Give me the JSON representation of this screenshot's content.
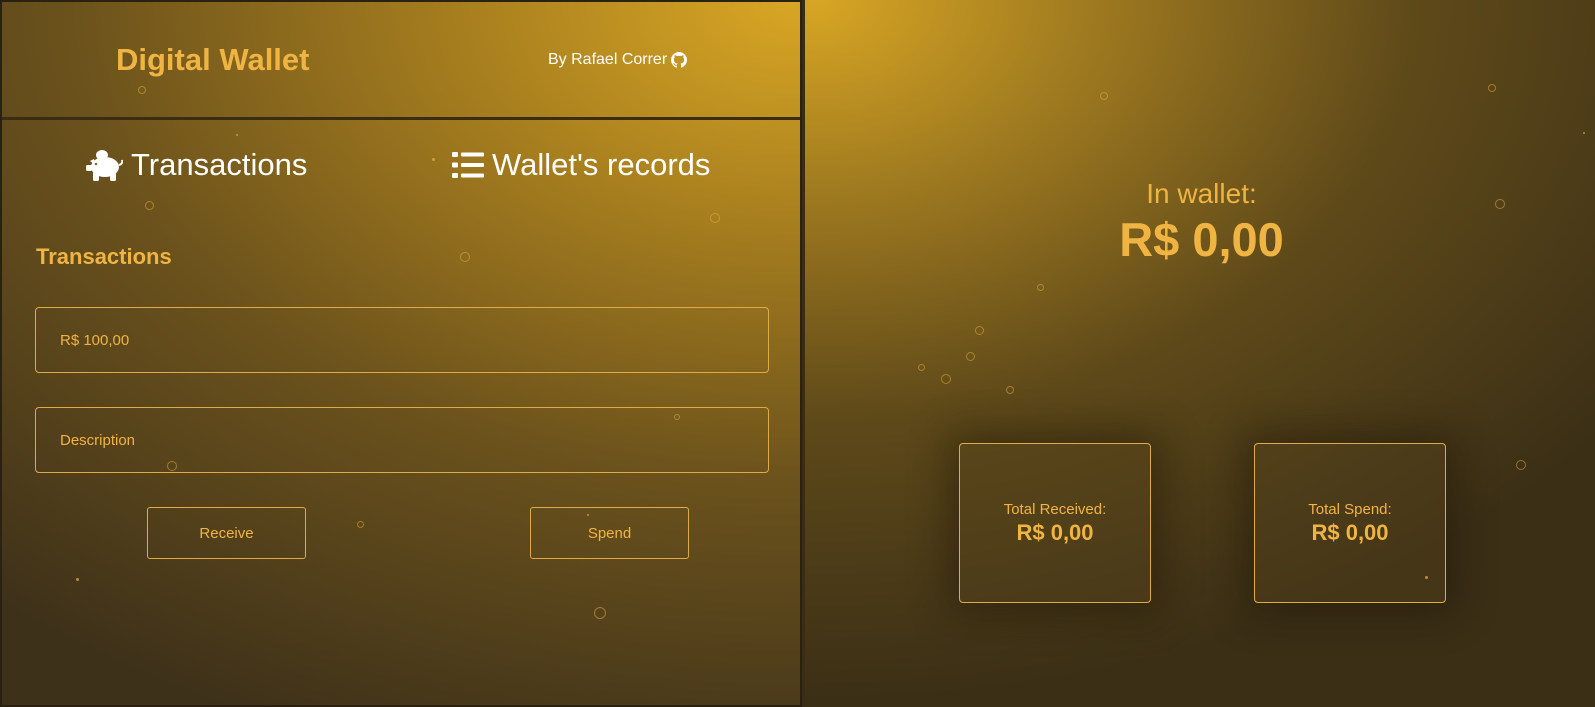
{
  "header": {
    "app_title": "Digital Wallet",
    "byline": "By Rafael Correr",
    "byline_icon": "github-icon"
  },
  "tabs": {
    "transactions": {
      "label": "Transactions",
      "icon": "piggy-bank-icon"
    },
    "records": {
      "label": "Wallet's records",
      "icon": "list-icon"
    }
  },
  "form": {
    "section_title": "Transactions",
    "amount": {
      "value": "",
      "placeholder": "R$ 100,00"
    },
    "description": {
      "value": "",
      "placeholder": "Description"
    },
    "receive_label": "Receive",
    "spend_label": "Spend"
  },
  "wallet": {
    "label": "In wallet:",
    "amount": "R$ 0,00"
  },
  "summary": {
    "received": {
      "label": "Total Received:",
      "value": "R$ 0,00"
    },
    "spend": {
      "label": "Total Spend:",
      "value": "R$ 0,00"
    }
  },
  "colors": {
    "accent": "#f0b443",
    "gold_light": "#d8a624",
    "background_dark": "#3b2f18"
  }
}
